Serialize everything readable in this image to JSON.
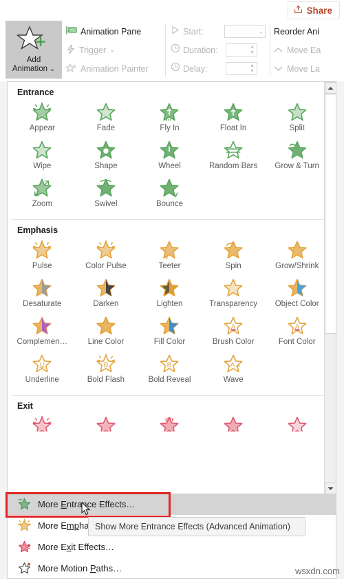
{
  "window": {
    "share_button": "Share",
    "share_icon": "share-icon"
  },
  "ribbon": {
    "add_animation": {
      "line1": "Add",
      "line2": "Animation",
      "icon": "star-plus-icon",
      "caret": "⌄"
    },
    "advanced_group": [
      {
        "label": "Animation Pane",
        "icon": "animation-pane-icon",
        "enabled": true,
        "caret": ""
      },
      {
        "label": "Trigger",
        "icon": "lightning-icon",
        "enabled": false,
        "caret": "⌄"
      },
      {
        "label": "Animation Painter",
        "icon": "star-brush-icon",
        "enabled": false,
        "caret": ""
      }
    ],
    "timing_group": [
      {
        "label": "Start:",
        "icon": "play-icon",
        "value": "",
        "control": "combo"
      },
      {
        "label": "Duration:",
        "icon": "clock-icon",
        "value": "",
        "control": "spinner"
      },
      {
        "label": "Delay:",
        "icon": "clock-delay-icon",
        "value": "",
        "control": "spinner"
      }
    ],
    "reorder_group": {
      "title": "Reorder Ani",
      "items": [
        {
          "label": "Move Ea",
          "icon": "chevron-up-icon"
        },
        {
          "label": "Move La",
          "icon": "chevron-down-icon"
        }
      ]
    }
  },
  "gallery": {
    "sections": [
      {
        "title": "Entrance",
        "color": "#58a55c",
        "items": [
          {
            "label": "Appear",
            "icon": "star-appear-icon"
          },
          {
            "label": "Fade",
            "icon": "star-fade-icon"
          },
          {
            "label": "Fly In",
            "icon": "star-fly-in-icon"
          },
          {
            "label": "Float In",
            "icon": "star-float-in-icon"
          },
          {
            "label": "Split",
            "icon": "star-split-icon"
          },
          {
            "label": "Wipe",
            "icon": "star-wipe-icon"
          },
          {
            "label": "Shape",
            "icon": "star-shape-icon"
          },
          {
            "label": "Wheel",
            "icon": "star-wheel-icon"
          },
          {
            "label": "Random Bars",
            "icon": "star-random-bars-icon"
          },
          {
            "label": "Grow & Turn",
            "icon": "star-grow-turn-icon"
          },
          {
            "label": "Zoom",
            "icon": "star-zoom-icon"
          },
          {
            "label": "Swivel",
            "icon": "star-swivel-icon"
          },
          {
            "label": "Bounce",
            "icon": "star-bounce-icon"
          }
        ]
      },
      {
        "title": "Emphasis",
        "color": "#e3a33a",
        "items": [
          {
            "label": "Pulse",
            "icon": "star-pulse-icon"
          },
          {
            "label": "Color Pulse",
            "icon": "star-color-pulse-icon"
          },
          {
            "label": "Teeter",
            "icon": "star-teeter-icon"
          },
          {
            "label": "Spin",
            "icon": "star-spin-icon"
          },
          {
            "label": "Grow/Shrink",
            "icon": "star-grow-shrink-icon"
          },
          {
            "label": "Desaturate",
            "icon": "star-desaturate-icon"
          },
          {
            "label": "Darken",
            "icon": "star-darken-icon"
          },
          {
            "label": "Lighten",
            "icon": "star-lighten-icon"
          },
          {
            "label": "Transparency",
            "icon": "star-transparency-icon"
          },
          {
            "label": "Object Color",
            "icon": "star-object-color-icon"
          },
          {
            "label": "Complemen…",
            "icon": "star-complementary-color-icon"
          },
          {
            "label": "Line Color",
            "icon": "star-line-color-icon"
          },
          {
            "label": "Fill Color",
            "icon": "star-fill-color-icon"
          },
          {
            "label": "Brush Color",
            "icon": "star-brush-color-icon"
          },
          {
            "label": "Font Color",
            "icon": "star-font-color-icon"
          },
          {
            "label": "Underline",
            "icon": "star-underline-icon"
          },
          {
            "label": "Bold Flash",
            "icon": "star-bold-flash-icon"
          },
          {
            "label": "Bold Reveal",
            "icon": "star-bold-reveal-icon"
          },
          {
            "label": "Wave",
            "icon": "star-wave-icon"
          }
        ]
      },
      {
        "title": "Exit",
        "color": "#e2566a",
        "items": [
          {
            "label": "",
            "icon": "star-disappear-icon"
          },
          {
            "label": "",
            "icon": "star-fade-out-icon"
          },
          {
            "label": "",
            "icon": "star-fly-out-icon"
          },
          {
            "label": "",
            "icon": "star-float-out-icon"
          },
          {
            "label": "",
            "icon": "star-split-out-icon"
          }
        ]
      }
    ],
    "scrollbar": {
      "up_arrow": "▲",
      "down_arrow": "▼"
    }
  },
  "menu": {
    "items": [
      {
        "label_pre": "More ",
        "hotkey": "E",
        "label_post": "ntrance Effects…",
        "icon": "star-entrance-icon",
        "selected": true
      },
      {
        "label_pre": "More E",
        "hotkey": "mp",
        "label_post": "hasis Effects…",
        "icon": "star-emphasis-icon",
        "selected": false
      },
      {
        "label_pre": "More E",
        "hotkey": "x",
        "label_post": "it Effects…",
        "icon": "star-exit-icon",
        "selected": false
      },
      {
        "label_pre": "More Motion ",
        "hotkey": "P",
        "label_post": "aths…",
        "icon": "star-motion-path-icon",
        "selected": false
      }
    ],
    "tooltip": "Show More Entrance Effects (Advanced Animation)"
  },
  "watermark": "wsxdn.com"
}
